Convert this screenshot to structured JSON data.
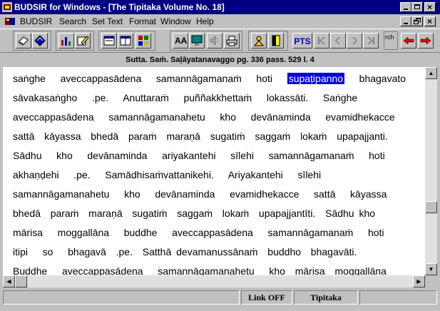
{
  "window": {
    "title": "BUDSIR for Windows - [The Tipitaka Volume No. 18]"
  },
  "menu": {
    "items": [
      "BUDSIR",
      "Search",
      "Set Text",
      "Format",
      "Window",
      "Help"
    ]
  },
  "toolbar": {
    "pts_label": "PTS",
    "search_snippet": "rch"
  },
  "header": {
    "reference": "Sutta. Saṁ. Saḷāyatanavaggo   pg. 336   pass. 529   l. 4"
  },
  "content": {
    "lines": [
      {
        "before": "saṅghe   aveccappasādena   samannāgamanaṁ   hoti   ",
        "highlight": "supaṭipanno",
        "after": "   bhagavato"
      },
      {
        "text": "sāvakasaṅgho   .pe.   Anuttaraṁ   puññakkhettaṁ   lokassāti.   Saṅghe"
      },
      {
        "text": "aveccappasādena   samannāgamanahetu   kho   devānaminda   evamidhekacce"
      },
      {
        "text": "sattā  kāyassa  bhedā  paraṁ  maraṇā  sugatiṁ  saggaṁ  lokaṁ  upapajjanti."
      },
      {
        "text": "Sādhu   kho   devānaminda   ariyakantehi   sīlehi   samannāgamanaṁ   hoti"
      },
      {
        "text": "akhaṇḍehi   .pe.   Samādhisaṁvattanikehi.   Ariyakantehi   sīlehi"
      },
      {
        "text": "samannāgamanahetu   kho   devānaminda   evamidhekacce   sattā   kāyassa"
      },
      {
        "text": "bhedā  paraṁ  maraṇā  sugatiṁ  saggaṁ  lokaṁ  upapajjantīti.  Sādhu kho"
      },
      {
        "text": "mārisa   moggallāna   buddhe   aveccappasādena   samannāgamanaṁ   hoti"
      },
      {
        "text": "itipi   so   bhagavā  .pe.  Satthā devamanussānaṁ  buddho  bhagavāti."
      },
      {
        "text": "Buddhe   aveccappasādena   samannāgamanahetu   kho  mārisa  moggallāna"
      }
    ]
  },
  "status": {
    "link": "Link OFF",
    "collection": "Tipitaka"
  },
  "colors": {
    "title_bg": "#000080",
    "highlight_bg": "#0000e0",
    "face": "#c0c0c0"
  }
}
